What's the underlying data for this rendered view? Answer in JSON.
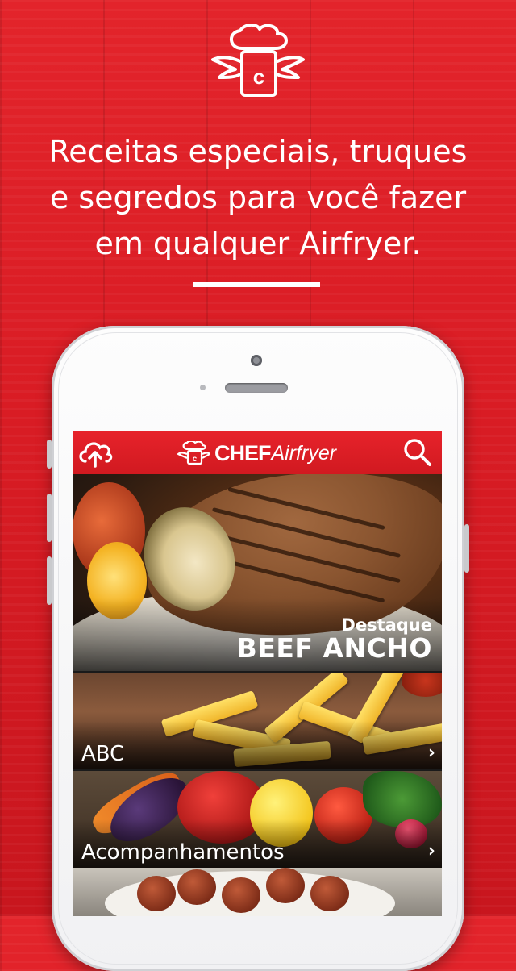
{
  "headline": {
    "line1": "Receitas especiais, truques",
    "line2": "e segredos para você fazer",
    "line3": "em qualquer Airfryer."
  },
  "app": {
    "brand_chef": "CHEF",
    "brand_airfryer": "Airfryer",
    "featured": {
      "kicker": "Destaque",
      "title": "BEEF ANCHO"
    },
    "categories": [
      {
        "label": "ABC"
      },
      {
        "label": "Acompanhamentos"
      }
    ]
  },
  "colors": {
    "background_red": "#d91c24",
    "appbar_red": "#e7232b",
    "text_white": "#ffffff"
  },
  "icons": {
    "top_logo": "chef-hat-c-winged-icon",
    "appbar_left": "cloud-upload-icon",
    "appbar_right": "search-icon",
    "category_arrow": "chevron-right-icon"
  }
}
